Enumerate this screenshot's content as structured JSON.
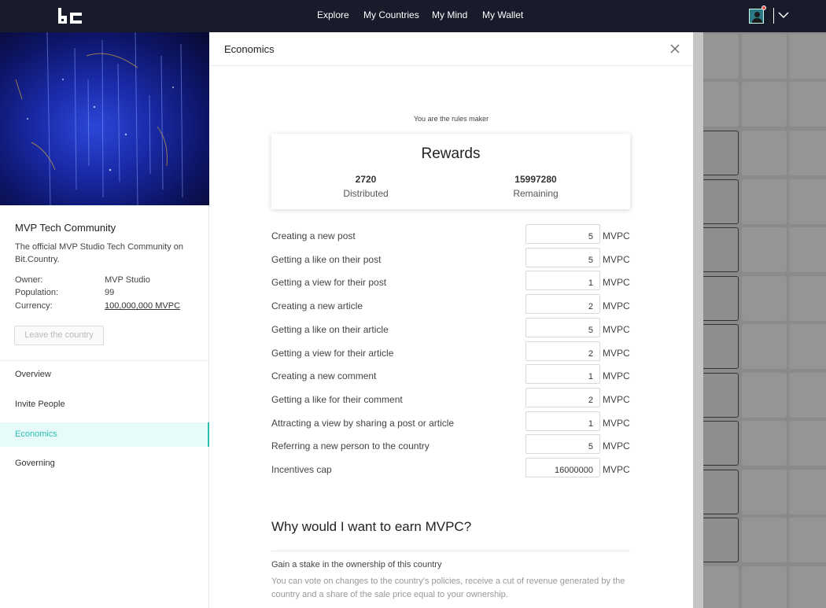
{
  "nav": {
    "items": [
      {
        "label": "Explore"
      },
      {
        "label": "My Countries"
      },
      {
        "label": "My Mind"
      },
      {
        "label": "My Wallet"
      }
    ]
  },
  "sidebar": {
    "community_title": "MVP Tech Community",
    "description": "The official MVP Studio Tech Community on Bit.Country.",
    "meta": [
      {
        "label": "Owner:",
        "value": "MVP Studio"
      },
      {
        "label": "Population:",
        "value": "99"
      },
      {
        "label": "Currency:",
        "value": "100,000,000 MVPC"
      }
    ],
    "leave_button": "Leave the country",
    "menu": [
      {
        "label": "Overview",
        "active": false
      },
      {
        "label": "Invite People",
        "active": false
      },
      {
        "label": "Economics",
        "active": true
      },
      {
        "label": "Governing",
        "active": false
      }
    ]
  },
  "modal": {
    "title": "Economics",
    "rules_maker": "You are the rules maker",
    "rewards": {
      "title": "Rewards",
      "distributed_value": "2720",
      "distributed_label": "Distributed",
      "remaining_value": "15997280",
      "remaining_label": "Remaining"
    },
    "unit": "MVPC",
    "rules": [
      {
        "label": "Creating a new post",
        "value": "5"
      },
      {
        "label": "Getting a like on their post",
        "value": "5"
      },
      {
        "label": "Getting a view for their post",
        "value": "1"
      },
      {
        "label": "Creating a new article",
        "value": "2"
      },
      {
        "label": "Getting a like on their article",
        "value": "5"
      },
      {
        "label": "Getting a view for their article",
        "value": "2"
      },
      {
        "label": "Creating a new comment",
        "value": "1"
      },
      {
        "label": "Getting a like for their comment",
        "value": "2"
      },
      {
        "label": "Attracting a view by sharing a post or article",
        "value": "1"
      },
      {
        "label": "Referring a new person to the country",
        "value": "5"
      },
      {
        "label": "Incentives cap",
        "value": "16000000"
      }
    ],
    "why": {
      "title": "Why would I want to earn MVPC?",
      "subtitle": "Gain a stake in the ownership of this country",
      "text": "You can vote on changes to the country's policies, receive a cut of revenue generated by the country and a share of the sale price equal to your ownership."
    }
  },
  "colors": {
    "topbar": "#181b2a",
    "accent": "#2bbfb3",
    "active_bg": "#e6fbfa"
  },
  "icons": [
    "logo-icon",
    "avatar-icon",
    "notification-dot-icon",
    "chevron-down-icon",
    "close-icon"
  ]
}
